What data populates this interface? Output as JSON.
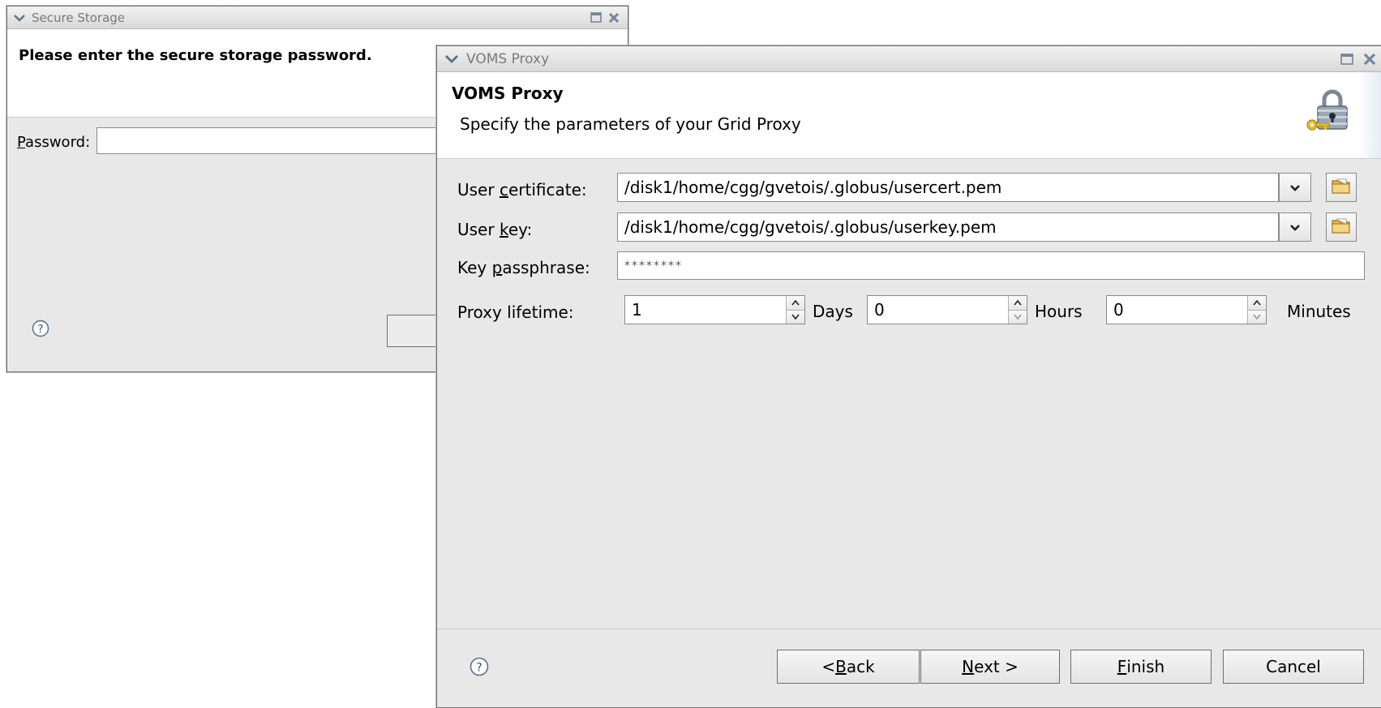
{
  "secure_storage": {
    "title": "Secure Storage",
    "message": "Please enter the secure storage password.",
    "password_label": "Password:",
    "password_mnemonic": "P",
    "password_label_rest": "assword:",
    "password_value": ""
  },
  "voms": {
    "title": "VOMS Proxy",
    "header_title": "VOMS Proxy",
    "header_subtitle": "Specify the parameters of your Grid Proxy",
    "user_certificate": {
      "label_pre": "User ",
      "label_mn": "c",
      "label_post": "ertificate:",
      "value": "/disk1/home/cgg/gvetois/.globus/usercert.pem"
    },
    "user_key": {
      "label_pre": "User ",
      "label_mn": "k",
      "label_post": "ey:",
      "value": "/disk1/home/cgg/gvetois/.globus/userkey.pem"
    },
    "key_passphrase": {
      "label_pre": "Key ",
      "label_mn": "p",
      "label_post": "assphrase:",
      "value": "********"
    },
    "proxy_lifetime": {
      "label": "Proxy lifetime:",
      "days": "1",
      "days_unit": "Days",
      "hours": "0",
      "hours_unit": "Hours",
      "minutes": "0",
      "minutes_unit": "Minutes"
    },
    "buttons": {
      "back_pre": "< ",
      "back_mn": "B",
      "back_post": "ack",
      "next_mn": "N",
      "next_post": "ext >",
      "finish_mn": "F",
      "finish_post": "inish",
      "cancel": "Cancel"
    }
  },
  "icons": {
    "window_menu": "chevron-down-icon",
    "maximize": "maximize-icon",
    "close": "close-icon",
    "help": "help-icon",
    "dropdown": "chevron-down-icon",
    "browse": "folder-icon",
    "header": "padlock-key-icon"
  },
  "colors": {
    "window_bg": "#e8e8e8",
    "titlebar_text": "#7a7a7a",
    "header_bg": "#ffffff",
    "border": "#6f6f6f"
  }
}
